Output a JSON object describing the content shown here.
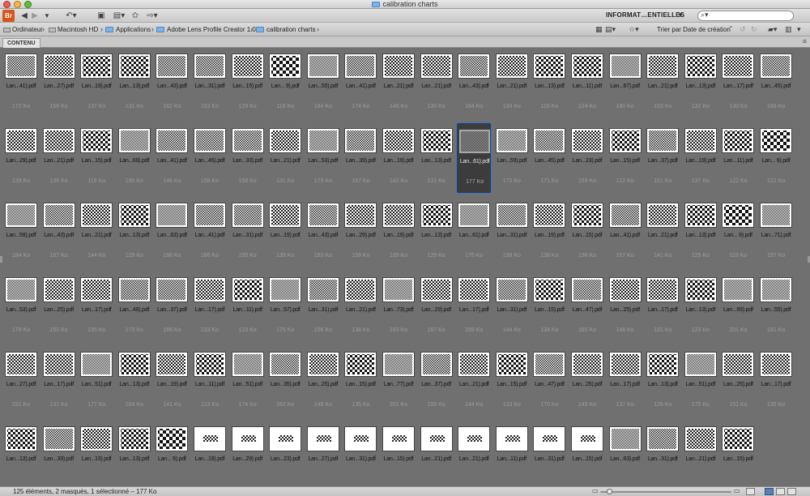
{
  "window": {
    "title": "calibration charts",
    "accent": "#2c7ae0"
  },
  "toolbar": {
    "app_logo": "Br",
    "workspace": "INFORMAT…ENTIELLES",
    "search_placeholder": ""
  },
  "breadcrumb": [
    {
      "label": "Ordinateur",
      "icon": "computer-icon"
    },
    {
      "label": "Macintosh HD",
      "icon": "drive-icon"
    },
    {
      "label": "Applications",
      "icon": "folder-icon"
    },
    {
      "label": "Adobe Lens Profile Creator 1.0",
      "icon": "folder-icon"
    },
    {
      "label": "calibration charts",
      "icon": "folder-icon"
    }
  ],
  "sort": {
    "label": "Trier par Date de création"
  },
  "panel": {
    "tab_label": "CONTENU"
  },
  "grid": {
    "columns": 21,
    "selected_index": 33,
    "items": [
      {
        "name": "Lan...41).pdf",
        "size": "172 Ko",
        "thumb": "fine"
      },
      {
        "name": "Lan...27).pdf",
        "size": "156 Ko",
        "thumb": "medium"
      },
      {
        "name": "Lan...19).pdf",
        "size": "137 Ko",
        "thumb": "coarse"
      },
      {
        "name": "Lan...13).pdf",
        "size": "131 Ko",
        "thumb": "coarse"
      },
      {
        "name": "Lan...43).pdf",
        "size": "162 Ko",
        "thumb": "fine"
      },
      {
        "name": "Lan...31).pdf",
        "size": "153 Ko",
        "thumb": "fine"
      },
      {
        "name": "Lan...15).pdf",
        "size": "129 Ko",
        "thumb": "medium"
      },
      {
        "name": "Lan... 9).pdf",
        "size": "118 Ko",
        "thumb": "big"
      },
      {
        "name": "Lan...55).pdf",
        "size": "184 Ko",
        "thumb": "xfine"
      },
      {
        "name": "Lan...41).pdf",
        "size": "174 Ko",
        "thumb": "fine"
      },
      {
        "name": "Lan...21).pdf",
        "size": "146 Ko",
        "thumb": "medium"
      },
      {
        "name": "Lan...21).pdf",
        "size": "130 Ko",
        "thumb": "medium"
      },
      {
        "name": "Lan...43).pdf",
        "size": "164 Ko",
        "thumb": "fine"
      },
      {
        "name": "Lan...21).pdf",
        "size": "134 Ko",
        "thumb": "medium"
      },
      {
        "name": "Lan...13).pdf",
        "size": "118 Ko",
        "thumb": "coarse"
      },
      {
        "name": "Lan...11).pdf",
        "size": "124 Ko",
        "thumb": "coarse"
      },
      {
        "name": "Lan...67).pdf",
        "size": "180 Ko",
        "thumb": "xfine"
      },
      {
        "name": "Lan...21).pdf",
        "size": "153 Ko",
        "thumb": "medium"
      },
      {
        "name": "Lan...13).pdf",
        "size": "132 Ko",
        "thumb": "coarse"
      },
      {
        "name": "Lan...17).pdf",
        "size": "130 Ko",
        "thumb": "medium"
      },
      {
        "name": "Lan...45).pdf",
        "size": "168 Ko",
        "thumb": "fine"
      },
      {
        "name": "Lan...29).pdf",
        "size": "139 Ko",
        "thumb": "medium"
      },
      {
        "name": "Lan...21).pdf",
        "size": "136 Ko",
        "thumb": "medium"
      },
      {
        "name": "Lan...15).pdf",
        "size": "119 Ko",
        "thumb": "coarse"
      },
      {
        "name": "Lan...69).pdf",
        "size": "190 Ko",
        "thumb": "xfine"
      },
      {
        "name": "Lan...41).pdf",
        "size": "146 Ko",
        "thumb": "fine"
      },
      {
        "name": "Lan...45).pdf",
        "size": "158 Ko",
        "thumb": "fine"
      },
      {
        "name": "Lan...33).pdf",
        "size": "158 Ko",
        "thumb": "fine"
      },
      {
        "name": "Lan...21).pdf",
        "size": "131 Ko",
        "thumb": "medium"
      },
      {
        "name": "Lan...53).pdf",
        "size": "179 Ko",
        "thumb": "xfine"
      },
      {
        "name": "Lan...39).pdf",
        "size": "167 Ko",
        "thumb": "fine"
      },
      {
        "name": "Lan...19).pdf",
        "size": "142 Ko",
        "thumb": "medium"
      },
      {
        "name": "Lan...13).pdf",
        "size": "131 Ko",
        "thumb": "coarse"
      },
      {
        "name": "Lan...61).pdf",
        "size": "177 Ko",
        "thumb": "xfine"
      },
      {
        "name": "Lan...59).pdf",
        "size": "170 Ko",
        "thumb": "xfine"
      },
      {
        "name": "Lan...45).pdf",
        "size": "171 Ko",
        "thumb": "fine"
      },
      {
        "name": "Lan...23).pdf",
        "size": "159 Ko",
        "thumb": "medium"
      },
      {
        "name": "Lan...15).pdf",
        "size": "122 Ko",
        "thumb": "coarse"
      },
      {
        "name": "Lan...37).pdf",
        "size": "151 Ko",
        "thumb": "fine"
      },
      {
        "name": "Lan...19).pdf",
        "size": "137 Ko",
        "thumb": "medium"
      },
      {
        "name": "Lan...11).pdf",
        "size": "122 Ko",
        "thumb": "coarse"
      },
      {
        "name": "Lan... 9).pdf",
        "size": "122 Ko",
        "thumb": "big"
      },
      {
        "name": "Lan...59).pdf",
        "size": "184 Ko",
        "thumb": "xfine"
      },
      {
        "name": "Lan...43).pdf",
        "size": "167 Ko",
        "thumb": "fine"
      },
      {
        "name": "Lan...21).pdf",
        "size": "144 Ko",
        "thumb": "medium"
      },
      {
        "name": "Lan...13).pdf",
        "size": "129 Ko",
        "thumb": "coarse"
      },
      {
        "name": "Lan...63).pdf",
        "size": "186 Ko",
        "thumb": "xfine"
      },
      {
        "name": "Lan...41).pdf",
        "size": "166 Ko",
        "thumb": "fine"
      },
      {
        "name": "Lan...31).pdf",
        "size": "155 Ko",
        "thumb": "fine"
      },
      {
        "name": "Lan...19).pdf",
        "size": "139 Ko",
        "thumb": "medium"
      },
      {
        "name": "Lan...43).pdf",
        "size": "163 Ko",
        "thumb": "fine"
      },
      {
        "name": "Lan...29).pdf",
        "size": "158 Ko",
        "thumb": "medium"
      },
      {
        "name": "Lan...19).pdf",
        "size": "139 Ko",
        "thumb": "medium"
      },
      {
        "name": "Lan...13).pdf",
        "size": "129 Ko",
        "thumb": "coarse"
      },
      {
        "name": "Lan...61).pdf",
        "size": "175 Ko",
        "thumb": "xfine"
      },
      {
        "name": "Lan...31).pdf",
        "size": "158 Ko",
        "thumb": "fine"
      },
      {
        "name": "Lan...19).pdf",
        "size": "138 Ko",
        "thumb": "medium"
      },
      {
        "name": "Lan...15).pdf",
        "size": "136 Ko",
        "thumb": "coarse"
      },
      {
        "name": "Lan...41).pdf",
        "size": "157 Ko",
        "thumb": "fine"
      },
      {
        "name": "Lan...21).pdf",
        "size": "141 Ko",
        "thumb": "medium"
      },
      {
        "name": "Lan...13).pdf",
        "size": "125 Ko",
        "thumb": "coarse"
      },
      {
        "name": "Lan... 9).pdf",
        "size": "119 Ko",
        "thumb": "big"
      },
      {
        "name": "Lan...71).pdf",
        "size": "197 Ko",
        "thumb": "xfine"
      },
      {
        "name": "Lan...53).pdf",
        "size": "179 Ko",
        "thumb": "xfine"
      },
      {
        "name": "Lan...25).pdf",
        "size": "150 Ko",
        "thumb": "medium"
      },
      {
        "name": "Lan...17).pdf",
        "size": "135 Ko",
        "thumb": "medium"
      },
      {
        "name": "Lan...49).pdf",
        "size": "173 Ko",
        "thumb": "fine"
      },
      {
        "name": "Lan...37).pdf",
        "size": "166 Ko",
        "thumb": "fine"
      },
      {
        "name": "Lan...17).pdf",
        "size": "133 Ko",
        "thumb": "medium"
      },
      {
        "name": "Lan...11).pdf",
        "size": "123 Ko",
        "thumb": "coarse"
      },
      {
        "name": "Lan...57).pdf",
        "size": "175 Ko",
        "thumb": "xfine"
      },
      {
        "name": "Lan...31).pdf",
        "size": "156 Ko",
        "thumb": "fine"
      },
      {
        "name": "Lan...21).pdf",
        "size": "138 Ko",
        "thumb": "medium"
      },
      {
        "name": "Lan...73).pdf",
        "size": "193 Ko",
        "thumb": "xfine"
      },
      {
        "name": "Lan...29).pdf",
        "size": "167 Ko",
        "thumb": "medium"
      },
      {
        "name": "Lan...17).pdf",
        "size": "159 Ko",
        "thumb": "medium"
      },
      {
        "name": "Lan...31).pdf",
        "size": "144 Ko",
        "thumb": "fine"
      },
      {
        "name": "Lan...15).pdf",
        "size": "134 Ko",
        "thumb": "coarse"
      },
      {
        "name": "Lan...47).pdf",
        "size": "165 Ko",
        "thumb": "fine"
      },
      {
        "name": "Lan...25).pdf",
        "size": "146 Ko",
        "thumb": "medium"
      },
      {
        "name": "Lan...17).pdf",
        "size": "131 Ko",
        "thumb": "medium"
      },
      {
        "name": "Lan...13).pdf",
        "size": "123 Ko",
        "thumb": "coarse"
      },
      {
        "name": "Lan...69).pdf",
        "size": "201 Ko",
        "thumb": "xfine"
      },
      {
        "name": "Lan...55).pdf",
        "size": "181 Ko",
        "thumb": "xfine"
      },
      {
        "name": "Lan...27).pdf",
        "size": "151 Ko",
        "thumb": "medium"
      },
      {
        "name": "Lan...17).pdf",
        "size": "131 Ko",
        "thumb": "medium"
      },
      {
        "name": "Lan...51).pdf",
        "size": "177 Ko",
        "thumb": "xfine"
      },
      {
        "name": "Lan...13).pdf",
        "size": "164 Ko",
        "thumb": "coarse"
      },
      {
        "name": "Lan...19).pdf",
        "size": "141 Ko",
        "thumb": "medium"
      },
      {
        "name": "Lan...11).pdf",
        "size": "123 Ko",
        "thumb": "coarse"
      },
      {
        "name": "Lan...51).pdf",
        "size": "174 Ko",
        "thumb": "xfine"
      },
      {
        "name": "Lan...35).pdf",
        "size": "162 Ko",
        "thumb": "fine"
      },
      {
        "name": "Lan...25).pdf",
        "size": "148 Ko",
        "thumb": "medium"
      },
      {
        "name": "Lan...15).pdf",
        "size": "135 Ko",
        "thumb": "coarse"
      },
      {
        "name": "Lan...77).pdf",
        "size": "201 Ko",
        "thumb": "xfine"
      },
      {
        "name": "Lan...37).pdf",
        "size": "159 Ko",
        "thumb": "fine"
      },
      {
        "name": "Lan...21).pdf",
        "size": "144 Ko",
        "thumb": "medium"
      },
      {
        "name": "Lan...15).pdf",
        "size": "133 Ko",
        "thumb": "coarse"
      },
      {
        "name": "Lan...47).pdf",
        "size": "170 Ko",
        "thumb": "fine"
      },
      {
        "name": "Lan...25).pdf",
        "size": "149 Ko",
        "thumb": "medium"
      },
      {
        "name": "Lan...17).pdf",
        "size": "137 Ko",
        "thumb": "medium"
      },
      {
        "name": "Lan...13).pdf",
        "size": "126 Ko",
        "thumb": "coarse"
      },
      {
        "name": "Lan...51).pdf",
        "size": "175 Ko",
        "thumb": "xfine"
      },
      {
        "name": "Lan...25).pdf",
        "size": "151 Ko",
        "thumb": "medium"
      },
      {
        "name": "Lan...17).pdf",
        "size": "135 Ko",
        "thumb": "medium"
      },
      {
        "name": "Lan...13).pdf",
        "size": "",
        "thumb": "coarse"
      },
      {
        "name": "Lan...39).pdf",
        "size": "",
        "thumb": "fine"
      },
      {
        "name": "Lan...19).pdf",
        "size": "",
        "thumb": "medium"
      },
      {
        "name": "Lan...13).pdf",
        "size": "",
        "thumb": "coarse"
      },
      {
        "name": "Lan... 9).pdf",
        "size": "",
        "thumb": "big"
      },
      {
        "name": "Lan...19).pdf",
        "size": "",
        "thumb": "wide"
      },
      {
        "name": "Lan...29).pdf",
        "size": "",
        "thumb": "wide"
      },
      {
        "name": "Lan...23).pdf",
        "size": "",
        "thumb": "wide"
      },
      {
        "name": "Lan...27).pdf",
        "size": "",
        "thumb": "wide"
      },
      {
        "name": "Lan...31).pdf",
        "size": "",
        "thumb": "wide"
      },
      {
        "name": "Lan...15).pdf",
        "size": "",
        "thumb": "wide"
      },
      {
        "name": "Lan...21).pdf",
        "size": "",
        "thumb": "wide"
      },
      {
        "name": "Lan...21).pdf",
        "size": "",
        "thumb": "wide"
      },
      {
        "name": "Lan...11).pdf",
        "size": "",
        "thumb": "wide"
      },
      {
        "name": "Lan...31).pdf",
        "size": "",
        "thumb": "wide"
      },
      {
        "name": "Lan...15).pdf",
        "size": "",
        "thumb": "wide"
      },
      {
        "name": "Lan...63).pdf",
        "size": "",
        "thumb": "xfine"
      },
      {
        "name": "Lan...31).pdf",
        "size": "",
        "thumb": "fine"
      },
      {
        "name": "Lan...21).pdf",
        "size": "",
        "thumb": "medium"
      },
      {
        "name": "Lan...15).pdf",
        "size": "",
        "thumb": "coarse"
      }
    ]
  },
  "status": {
    "text": "125 éléments, 2 masqués, 1 sélectionné – 177 Ko",
    "zoom_fraction": 0.05
  }
}
